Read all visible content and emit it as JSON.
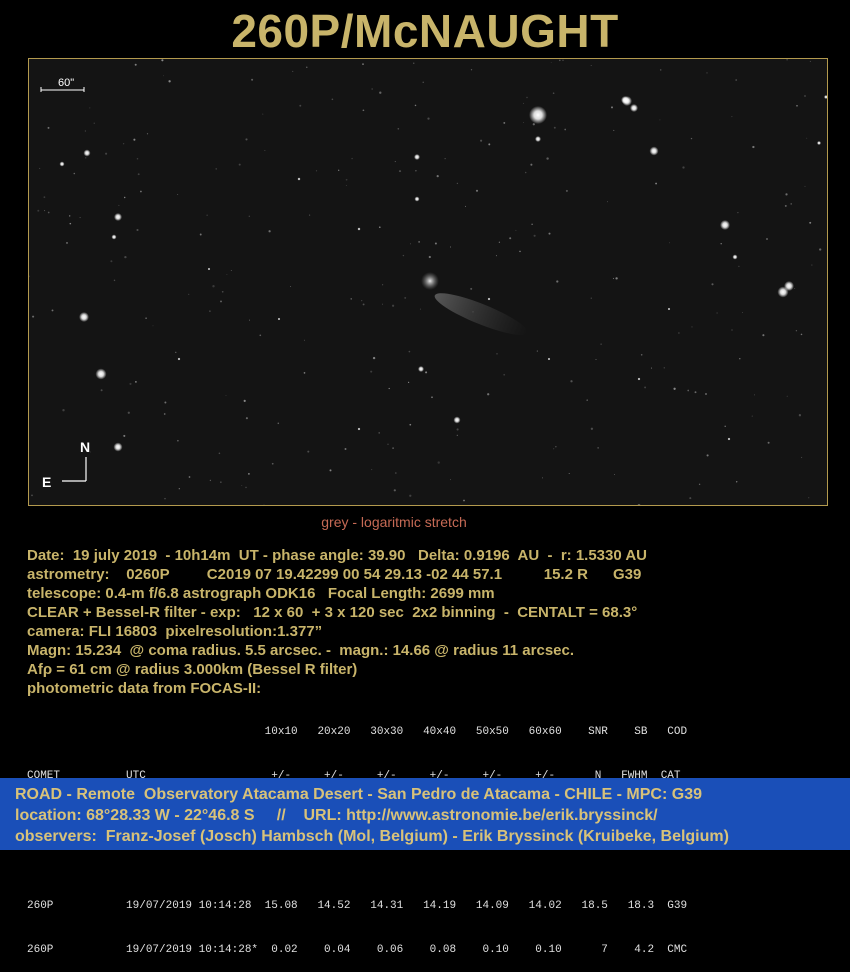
{
  "title": "260P/McNAUGHT",
  "image": {
    "scale_label": "60\"",
    "north_label": "N",
    "east_label": "E"
  },
  "caption": "grey - logaritmic stretch",
  "info_lines": [
    "Date:  19 july 2019  - 10h14m  UT - phase angle: 39.90   Delta: 0.9196  AU  -  r: 1.5330 AU",
    "astrometry:    0260P         C2019 07 19.42299 00 54 29.13 -02 44 57.1          15.2 R      G39",
    "telescope: 0.4-m f/6.8 astrograph ODK16   Focal Length: 2699 mm",
    "CLEAR + Bessel-R filter - exp:   12 x 60  + 3 x 120 sec  2x2 binning  -  CENTALT = 68.3°",
    "camera: FLI 16803  pixelresolution:1.377”",
    "Magn: 15.234  @ coma radius. 5.5 arcsec. -  magn.: 14.66 @ radius 11 arcsec.",
    "Afρ = 61 cm @ radius 3.000km (Bessel R filter)",
    "photometric data from FOCAS-II:"
  ],
  "photometry": {
    "header1": "                                    10x10   20x20   30x30   40x40   50x50   60x60    SNR    SB   COD",
    "header2": "COMET          UTC                   +/-     +/-     +/-     +/-     +/-     +/-      N   FWHM  CAT",
    "divider": "------------   -------------------  ------  -----   -----   -----   -----   -----   ----   ----  ---",
    "rows": [
      "260P           19/07/2019 10:14:28  15.08   14.52   14.31   14.19   14.09   14.02   18.5   18.3  G39",
      "260P           19/07/2019 10:14:28*  0.02    0.04    0.06    0.08    0.10    0.10      7    4.2  CMC"
    ]
  },
  "footer": {
    "line1": "ROAD - Remote  Observatory Atacama Desert - San Pedro de Atacama - CHILE - MPC: G39",
    "line2": "location: 68°28.33 W - 22°46.8 S     //    URL: http://www.astronomie.be/erik.bryssinck/",
    "line3": "observers:  Franz-Josef (Josch) Hambsch (Mol, Belgium) - Erik Bryssinck (Kruibeke, Belgium)"
  },
  "colors": {
    "title": "#c8b46a",
    "caption": "#c66a55",
    "footer_bg": "#1a4fb8",
    "footer_text": "#d8c27a"
  }
}
